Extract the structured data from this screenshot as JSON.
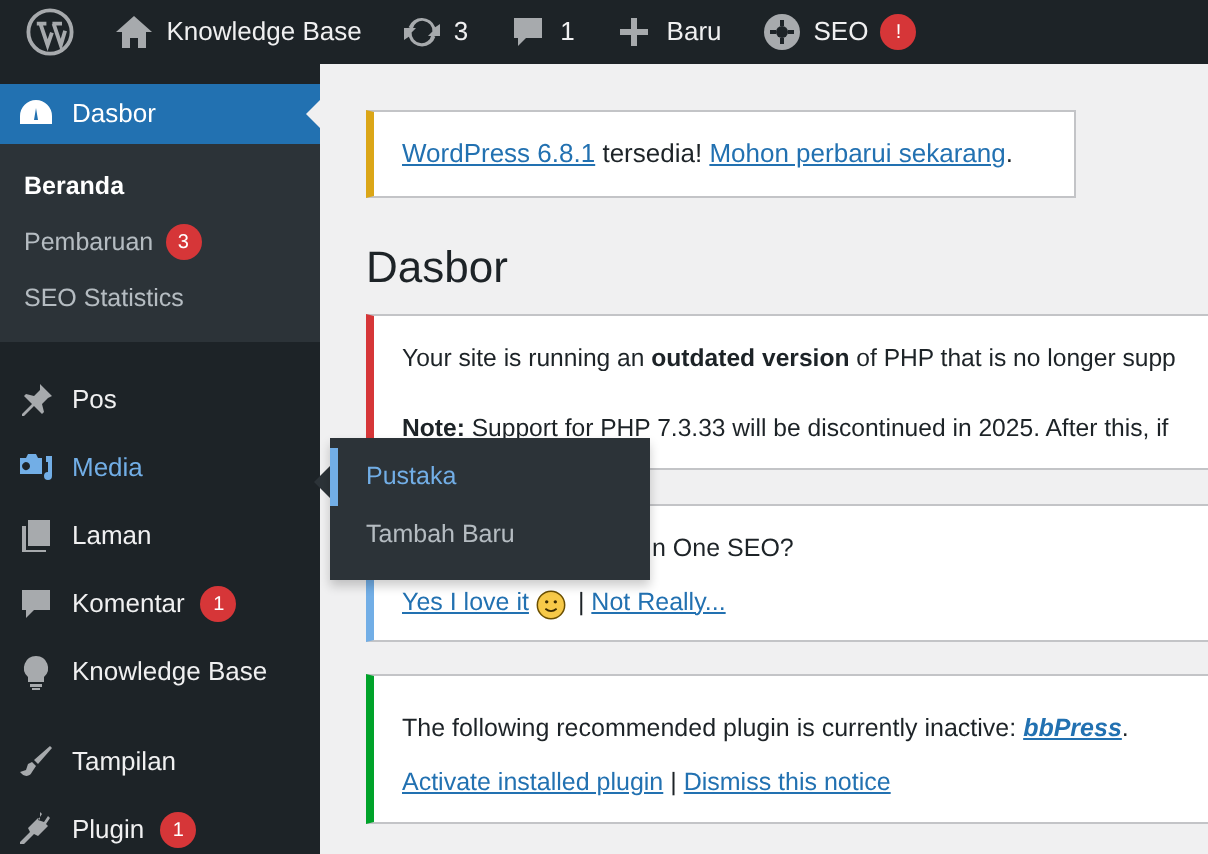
{
  "admin_bar": {
    "items": [
      {
        "kind": "site",
        "label": "Knowledge Base"
      },
      {
        "kind": "updates",
        "label": "3"
      },
      {
        "kind": "comments",
        "label": "1"
      },
      {
        "kind": "new",
        "label": "Baru"
      },
      {
        "kind": "seo",
        "label": "SEO",
        "badge": "!"
      }
    ]
  },
  "sidebar": {
    "groups": [
      {
        "items": [
          {
            "kind": "dashboard",
            "label": "Dasbor",
            "selected": true,
            "hover": false,
            "children": [
              {
                "label": "Beranda",
                "selected": true
              },
              {
                "label": "Pembaruan",
                "selected": false,
                "badge": "3"
              },
              {
                "label": "SEO Statistics",
                "selected": false
              }
            ]
          },
          {
            "kind": "pin",
            "label": "Pos",
            "selected": false,
            "hover": false
          },
          {
            "kind": "media",
            "label": "Media",
            "selected": false,
            "hover": true
          },
          {
            "kind": "pages",
            "label": "Laman",
            "selected": false,
            "hover": false
          },
          {
            "kind": "comment",
            "label": "Komentar",
            "selected": false,
            "hover": false,
            "badge": "1"
          },
          {
            "kind": "bulb",
            "label": "Knowledge Base",
            "selected": false,
            "hover": false
          }
        ]
      },
      {
        "items": [
          {
            "kind": "brush",
            "label": "Tampilan",
            "selected": false,
            "hover": false
          },
          {
            "kind": "plug",
            "label": "Plugin",
            "selected": false,
            "hover": false,
            "badge": "1"
          }
        ]
      }
    ]
  },
  "flyout": {
    "items": [
      {
        "label": "Pustaka",
        "selected": true
      },
      {
        "label": "Tambah Baru",
        "selected": false
      }
    ]
  },
  "update_notice": {
    "parts": [
      {
        "kind": "link",
        "text": "WordPress 6.8.1"
      },
      {
        "kind": "text",
        "text": " tersedia! "
      },
      {
        "kind": "link",
        "text": "Mohon perbarui sekarang"
      },
      {
        "kind": "text",
        "text": "."
      }
    ]
  },
  "heading": "Dasbor",
  "notices": [
    {
      "kind": "error",
      "lines": [
        [
          {
            "kind": "text",
            "text": "Your site is running an **outdated version** of PHP that is no longer supp"
          }
        ],
        [
          {
            "kind": "text",
            "text": "**Note:** Support for PHP 7.3.33 will be discontinued in 2025. After this, if"
          }
        ]
      ]
    },
    {
      "kind": "info",
      "lines": [
        [
          {
            "kind": "text",
            "text": "n One SEO?"
          }
        ],
        [
          {
            "kind": "link",
            "text": "Yes I love it"
          },
          {
            "kind": "smiley"
          },
          {
            "kind": "text",
            "text": " | "
          },
          {
            "kind": "link",
            "text": "Not Really..."
          }
        ]
      ]
    },
    {
      "kind": "success",
      "lines": [
        [
          {
            "kind": "text",
            "text": "The following recommended plugin is currently inactive: "
          },
          {
            "kind": "emlink",
            "text": "bbPress"
          },
          {
            "kind": "text",
            "text": "."
          }
        ],
        [
          {
            "kind": "link",
            "text": "Activate installed plugin"
          },
          {
            "kind": "text",
            "text": " | "
          },
          {
            "kind": "link",
            "text": "Dismiss this notice"
          }
        ]
      ]
    }
  ]
}
